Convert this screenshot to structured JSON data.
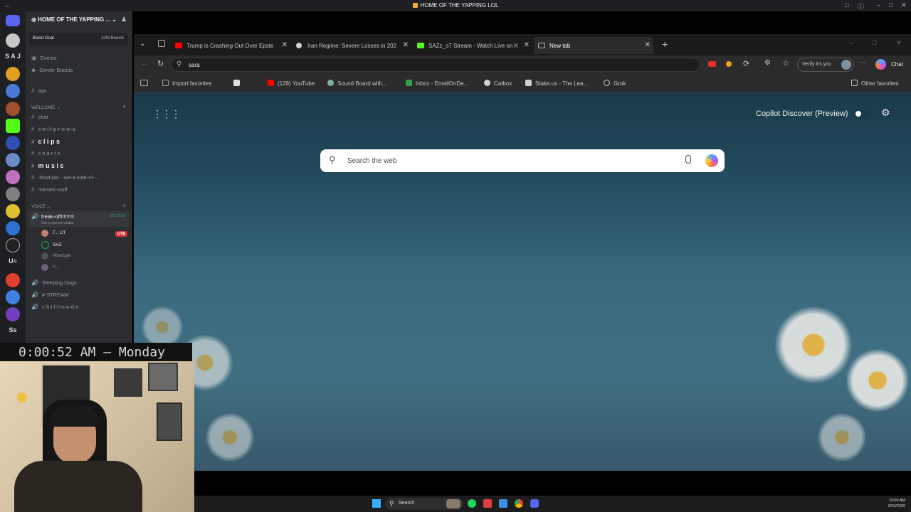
{
  "window": {
    "title": "HOME OF THE YAPPING LOL"
  },
  "discord": {
    "server_name": "HOME OF THE YAPPING ...",
    "boost_goal": "Boost Goal",
    "boost_count": "2/33 Boosts",
    "rail_initials": [
      "S A J",
      "Ss"
    ],
    "menu": [
      "Events",
      "Server Boosts"
    ],
    "top_channel": "ayo",
    "welcome_category": "WELCOME",
    "channels": [
      "chat",
      "s-e-l-f-p-r-o-m-o",
      "c l i p s",
      "c h a r t s",
      "m u s i c",
      "-food-pic-   -wit-a-side-of-...",
      "memes-stuff"
    ],
    "voice_category": "VOICE",
    "active_voice": "freak-off!!!!!!!!!",
    "active_voice_timer": "26:37:59",
    "channel_status": "Set a channel status",
    "voice_members": [
      "T... LIT",
      "SAZ",
      "Woodzye",
      "Y..."
    ],
    "live_badge": "LIVE",
    "other_voice": [
      "Sleeping Dogs",
      "# STREAM",
      "c-h-i-l-l-m-o-d-e"
    ]
  },
  "browser": {
    "tabs": [
      {
        "label": "Trump is Crashing Out Over Epste",
        "color": "#ff0000"
      },
      {
        "label": "Iran Regime: Severe Losses in 202",
        "color": "#d0d0d0"
      },
      {
        "label": "SAZz_o7 Stream - Watch Live on K",
        "color": "#53fc18"
      },
      {
        "label": "New tab",
        "color": "#aab4c0"
      }
    ],
    "address_text": "sara",
    "verify_text": "Verify it's you",
    "chat_label": "Chat",
    "favorites": [
      {
        "label": "Import favorites",
        "color": "#9aa0a6"
      },
      {
        "label": "",
        "color": "#e0e0e0"
      },
      {
        "label": "(128) YouTube",
        "color": "#ff0000"
      },
      {
        "label": "Sound Board with...",
        "color": "#7fb0a0"
      },
      {
        "label": "Inbox - EmailOnDe...",
        "color": "#30a050"
      },
      {
        "label": "Catbox",
        "color": "#d0d0d0"
      },
      {
        "label": "Stake.us - The Lea...",
        "color": "#d0d0d0"
      },
      {
        "label": "Grok",
        "color": "#d0d0d0"
      }
    ],
    "other_favorites": "Other favorites",
    "copilot_discover": "Copilot Discover (Preview)",
    "search_placeholder": "Search the web"
  },
  "overlay": {
    "clock": "0:00:52 AM – Monday"
  },
  "taskbar": {
    "search_label": "Search",
    "time": "10:00 AM",
    "date": "3/23/2026"
  }
}
